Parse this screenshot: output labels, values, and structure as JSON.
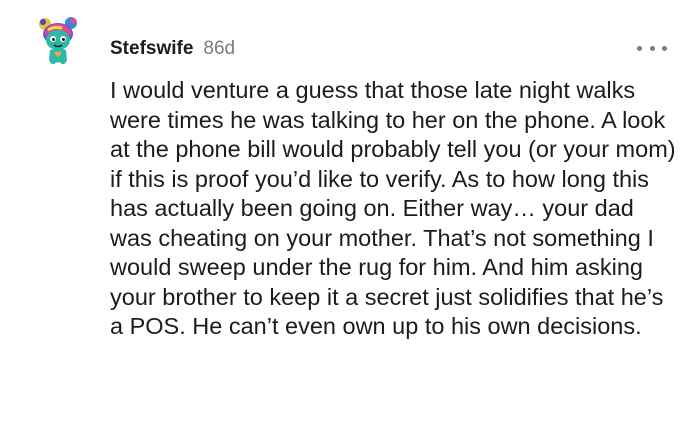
{
  "comment": {
    "author": "Stefswife",
    "age": "86d",
    "text": "I would venture a guess that those late night walks were times he was talking to her on the phone. A look at the phone bill would probably tell you (or your mom) if this is proof you’d like to verify. As to how long this has actually been going on. Either way… your dad was cheating on your mother. That’s not something I would sweep under the rug for him. And him asking your brother to keep it a secret just solidifies that he’s a POS. He can’t even own up to his own decisions."
  },
  "icons": {
    "avatar": "snoo-avatar-icon",
    "more": "more-options-icon"
  },
  "colors": {
    "text": "#1c1c1c",
    "meta": "#7c7c7c",
    "avatar_body": "#2fb7a8",
    "background": "#ffffff"
  }
}
